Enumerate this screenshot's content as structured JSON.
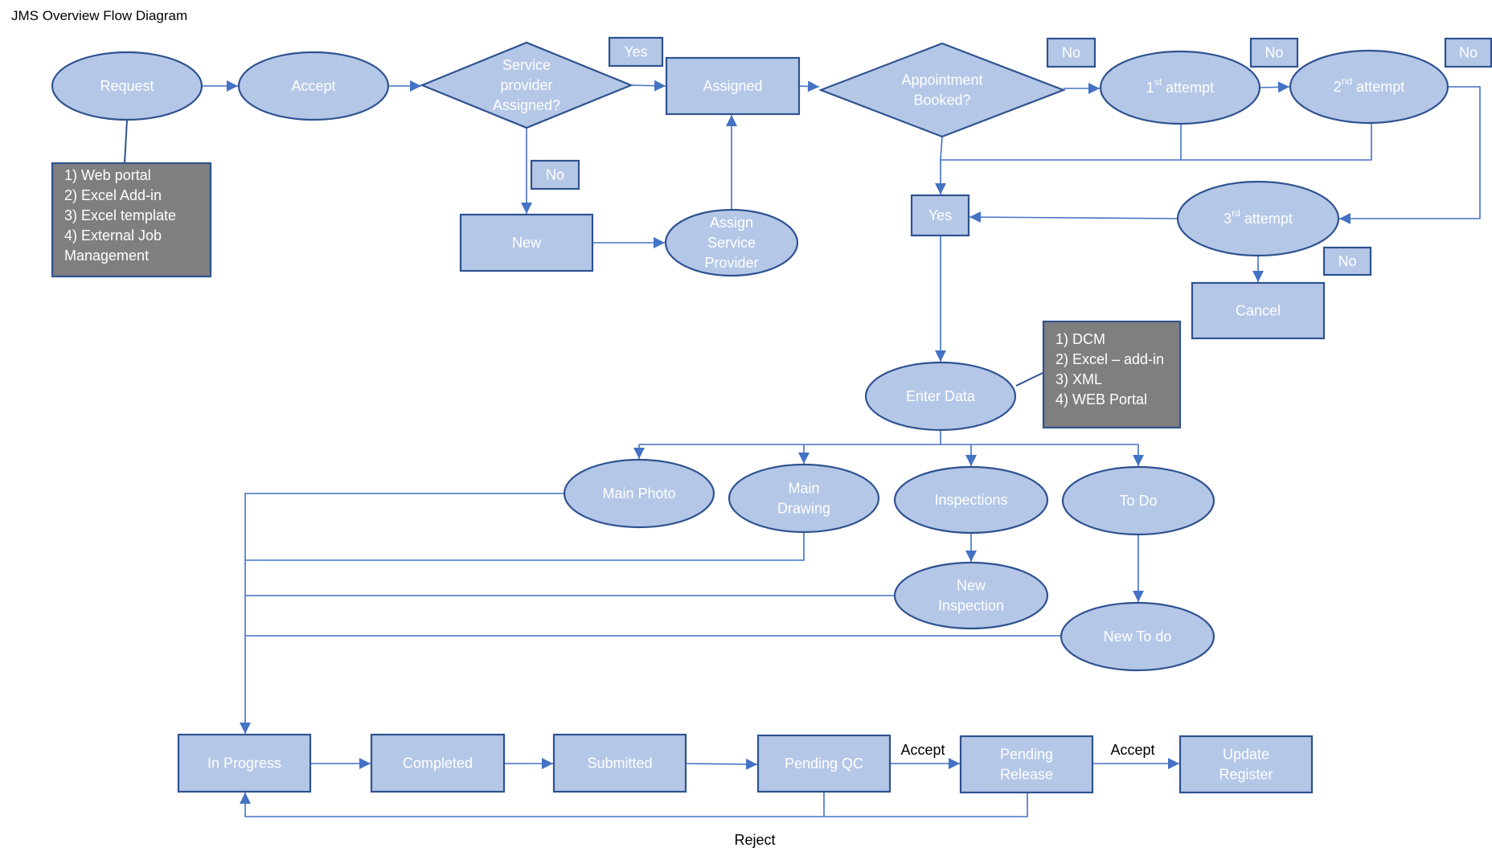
{
  "title": "JMS Overview Flow Diagram",
  "colors": {
    "node_fill": "#b4c7e7",
    "node_stroke": "#2f528f",
    "connector": "#4472c4",
    "note_fill": "#7f7f7f",
    "node_text": "#ffffff"
  },
  "nodes": {
    "request": {
      "lines": [
        "Request"
      ],
      "shape": "ellipse"
    },
    "accept": {
      "lines": [
        "Accept"
      ],
      "shape": "ellipse"
    },
    "sp_assigned": {
      "lines": [
        "Service",
        "provider",
        "Assigned?"
      ],
      "shape": "diamond"
    },
    "sp_yes": {
      "lines": [
        "Yes"
      ],
      "shape": "rect"
    },
    "assigned": {
      "lines": [
        "Assigned"
      ],
      "shape": "rect"
    },
    "sp_no": {
      "lines": [
        "No"
      ],
      "shape": "rect"
    },
    "new": {
      "lines": [
        "New"
      ],
      "shape": "rect"
    },
    "assign_sp": {
      "lines": [
        "Assign",
        "Service",
        "Provider"
      ],
      "shape": "ellipse"
    },
    "appt_booked": {
      "lines": [
        "Appointment",
        "Booked?"
      ],
      "shape": "diamond"
    },
    "appt_no": {
      "lines": [
        "No"
      ],
      "shape": "rect"
    },
    "attempt1": {
      "lines": [
        "1|st| attempt"
      ],
      "shape": "ellipse"
    },
    "attempt1_no": {
      "lines": [
        "No"
      ],
      "shape": "rect"
    },
    "attempt2": {
      "lines": [
        "2|nd|  attempt"
      ],
      "shape": "ellipse"
    },
    "attempt2_no": {
      "lines": [
        "No"
      ],
      "shape": "rect"
    },
    "yes_mid": {
      "lines": [
        "Yes"
      ],
      "shape": "rect"
    },
    "attempt3": {
      "lines": [
        "3|rd| attempt"
      ],
      "shape": "ellipse"
    },
    "attempt3_no": {
      "lines": [
        "No"
      ],
      "shape": "rect"
    },
    "cancel": {
      "lines": [
        "Cancel"
      ],
      "shape": "rect"
    },
    "enter_data": {
      "lines": [
        "Enter Data"
      ],
      "shape": "ellipse"
    },
    "main_photo": {
      "lines": [
        "Main Photo"
      ],
      "shape": "ellipse"
    },
    "main_drawing": {
      "lines": [
        "Main",
        "Drawing"
      ],
      "shape": "ellipse"
    },
    "inspections": {
      "lines": [
        "Inspections"
      ],
      "shape": "ellipse"
    },
    "todo": {
      "lines": [
        "To Do"
      ],
      "shape": "ellipse"
    },
    "new_inspection": {
      "lines": [
        "New",
        "Inspection"
      ],
      "shape": "ellipse"
    },
    "new_todo": {
      "lines": [
        "New To do"
      ],
      "shape": "ellipse"
    },
    "in_progress": {
      "lines": [
        "In Progress"
      ],
      "shape": "rect"
    },
    "completed": {
      "lines": [
        "Completed"
      ],
      "shape": "rect"
    },
    "submitted": {
      "lines": [
        "Submitted"
      ],
      "shape": "rect"
    },
    "pending_qc": {
      "lines": [
        "Pending QC"
      ],
      "shape": "rect"
    },
    "pending_release": {
      "lines": [
        "Pending",
        "Release"
      ],
      "shape": "rect"
    },
    "update_register": {
      "lines": [
        "Update",
        "Register"
      ],
      "shape": "rect"
    }
  },
  "notes": {
    "request_sources": [
      "1) Web portal",
      "2) Excel Add-in",
      "3) Excel template",
      "4) External Job",
      "Management"
    ],
    "data_entry_methods": [
      "1) DCM",
      "2) Excel – add-in",
      "3) XML",
      "4) WEB Portal"
    ]
  },
  "edge_labels": {
    "qc_accept": "Accept",
    "release_accept": "Accept",
    "reject": "Reject"
  }
}
